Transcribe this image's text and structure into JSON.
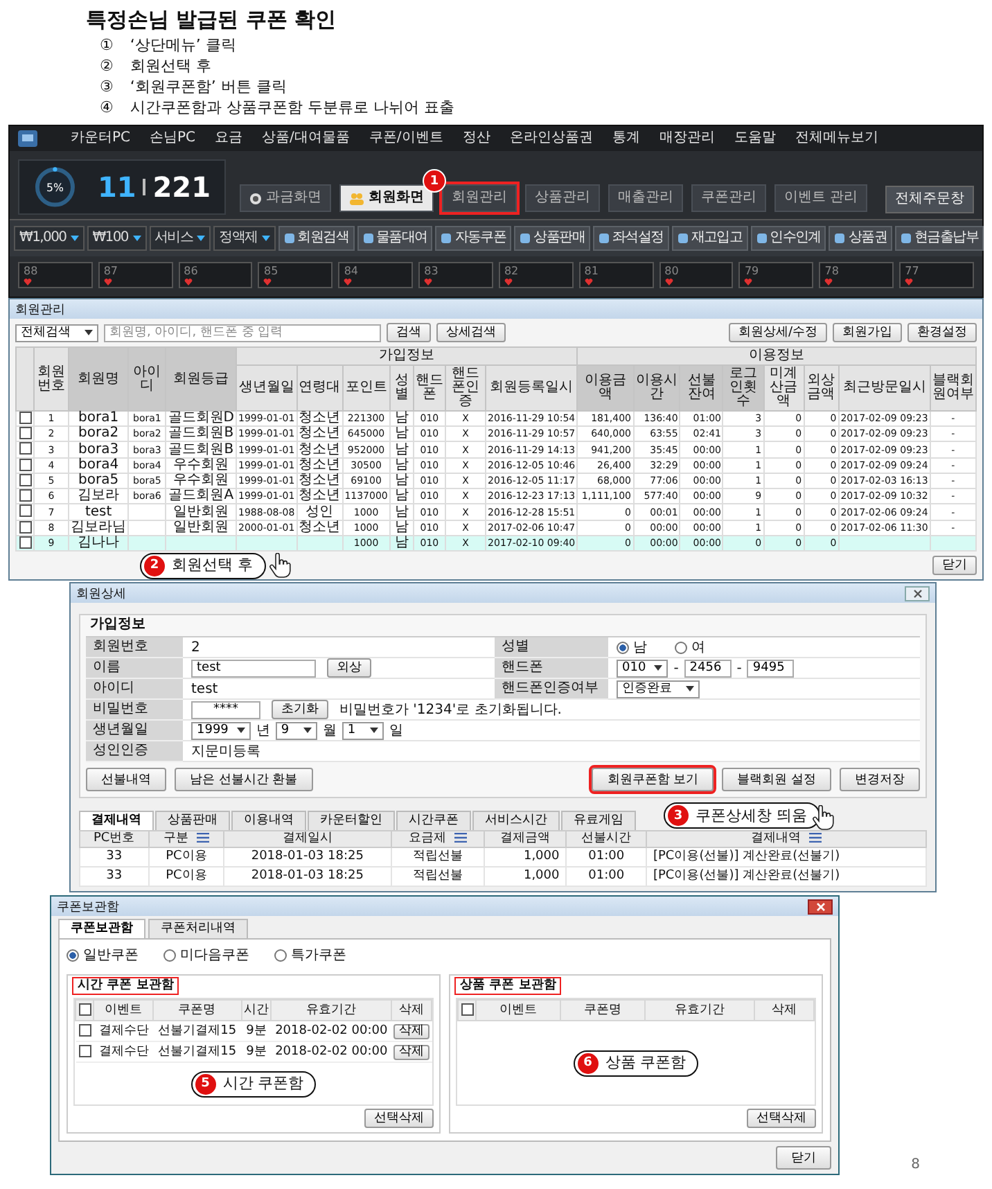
{
  "doc": {
    "title": "특정손님 발급된 쿠폰 확인",
    "steps": [
      {
        "marker": "①",
        "text": "‘상단메뉴’ 클릭"
      },
      {
        "marker": "②",
        "text": "회원선택 후"
      },
      {
        "marker": "③",
        "text": "‘회원쿠폰함’ 버튼 클릭"
      },
      {
        "marker": "④",
        "text": "시간쿠폰함과 상품쿠폰함 두분류로 나뉘어 표출"
      }
    ],
    "page_number": "8"
  },
  "main_app": {
    "menu": [
      "카운터PC",
      "손님PC",
      "요금",
      "상품/대여물품",
      "쿠폰/이벤트",
      "정산",
      "온라인상품권",
      "통계",
      "매장관리",
      "도움말",
      "전체메뉴보기"
    ],
    "usage": "5%",
    "count_used": "11",
    "count_total": "221",
    "tabs": [
      {
        "label": "과금화면",
        "selected": false,
        "highlighted": false
      },
      {
        "label": "회원화면",
        "selected": true,
        "highlighted": false
      },
      {
        "label": "회원관리",
        "selected": false,
        "highlighted": true
      },
      {
        "label": "상품관리",
        "selected": false,
        "highlighted": false
      },
      {
        "label": "매출관리",
        "selected": false,
        "highlighted": false
      },
      {
        "label": "쿠폰관리",
        "selected": false,
        "highlighted": false
      },
      {
        "label": "이벤트 관리",
        "selected": false,
        "highlighted": false
      }
    ],
    "callout": {
      "number": "1"
    },
    "order_button": "전체주문창",
    "toolbar": [
      {
        "kind": "dropdown",
        "label": "₩1,000"
      },
      {
        "kind": "dropdown",
        "label": "₩100"
      },
      {
        "kind": "dropdown",
        "label": "서비스"
      },
      {
        "kind": "dropdown",
        "label": "정액제"
      },
      {
        "kind": "button",
        "label": "회원검색"
      },
      {
        "kind": "button",
        "label": "물품대여"
      },
      {
        "kind": "button",
        "label": "자동쿠폰"
      },
      {
        "kind": "button",
        "label": "상품판매"
      },
      {
        "kind": "button",
        "label": "좌석설정"
      },
      {
        "kind": "button",
        "label": "재고입고"
      },
      {
        "kind": "button",
        "label": "인수인계"
      },
      {
        "kind": "button",
        "label": "상품권"
      },
      {
        "kind": "button",
        "label": "현금출납부"
      }
    ],
    "seats": [
      "88",
      "87",
      "86",
      "85",
      "84",
      "83",
      "82",
      "81",
      "80",
      "79",
      "78",
      "77"
    ]
  },
  "member_window": {
    "title": "회원관리",
    "search": {
      "scope": "전체검색",
      "placeholder": "회원명, 아이디, 핸드폰 중 입력",
      "buttons": [
        "검색",
        "상세검색"
      ]
    },
    "actions": [
      "회원상세/수정",
      "회원가입",
      "환경설정"
    ],
    "lead_columns": [
      "회원번호",
      "회원명",
      "아이디",
      "회원등급"
    ],
    "groups": [
      {
        "label": "가입정보",
        "columns": [
          "생년월일",
          "연령대",
          "포인트",
          "성별",
          "핸드폰",
          "핸드폰인증",
          "회원등록일시"
        ]
      },
      {
        "label": "이용정보",
        "columns": [
          "이용금액",
          "이용시간",
          "선불잔여",
          "로그인횟수",
          "미계산금액",
          "외상금액",
          "최근방문일시",
          "블랙회원여부"
        ]
      }
    ],
    "rows": [
      {
        "checked": false,
        "selected": false,
        "cells": [
          "1",
          "bora1",
          "bora1",
          "골드회원D",
          "1999-01-01",
          "청소년",
          "221300",
          "남",
          "010",
          "X",
          "2016-11-29 10:54",
          "181,400",
          "136:40",
          "01:00",
          "3",
          "0",
          "0",
          "2017-02-09 09:23",
          "-"
        ]
      },
      {
        "checked": false,
        "selected": false,
        "cells": [
          "2",
          "bora2",
          "bora2",
          "골드회원B",
          "1999-01-01",
          "청소년",
          "645000",
          "남",
          "010",
          "X",
          "2016-11-29 10:57",
          "640,000",
          "63:55",
          "02:41",
          "3",
          "0",
          "0",
          "2017-02-09 09:23",
          "-"
        ]
      },
      {
        "checked": false,
        "selected": false,
        "cells": [
          "3",
          "bora3",
          "bora3",
          "골드회원B",
          "1999-01-01",
          "청소년",
          "952000",
          "남",
          "010",
          "X",
          "2016-11-29 14:13",
          "941,200",
          "35:45",
          "00:00",
          "1",
          "0",
          "0",
          "2017-02-09 09:23",
          "-"
        ]
      },
      {
        "checked": false,
        "selected": false,
        "cells": [
          "4",
          "bora4",
          "bora4",
          "우수회원",
          "1999-01-01",
          "청소년",
          "30500",
          "남",
          "010",
          "X",
          "2016-12-05 10:46",
          "26,400",
          "32:29",
          "00:00",
          "1",
          "0",
          "0",
          "2017-02-09 09:24",
          "-"
        ]
      },
      {
        "checked": false,
        "selected": false,
        "cells": [
          "5",
          "bora5",
          "bora5",
          "우수회원",
          "1999-01-01",
          "청소년",
          "69100",
          "남",
          "010",
          "X",
          "2016-12-05 11:17",
          "68,000",
          "77:06",
          "00:00",
          "1",
          "0",
          "0",
          "2017-02-03 16:13",
          "-"
        ]
      },
      {
        "checked": false,
        "selected": false,
        "cells": [
          "6",
          "김보라",
          "bora6",
          "골드회원A",
          "1999-01-01",
          "청소년",
          "1137000",
          "남",
          "010",
          "X",
          "2016-12-23 17:13",
          "1,111,100",
          "577:40",
          "00:00",
          "9",
          "0",
          "0",
          "2017-02-09 10:32",
          "-"
        ]
      },
      {
        "checked": false,
        "selected": false,
        "cells": [
          "7",
          "test",
          null,
          "일반회원",
          "1988-08-08",
          "성인",
          "1000",
          "남",
          "010",
          "X",
          "2016-12-28 15:51",
          "0",
          "00:01",
          "00:00",
          "1",
          "0",
          "0",
          "2017-02-06 09:24",
          "-"
        ]
      },
      {
        "checked": false,
        "selected": false,
        "cells": [
          "8",
          "김보라님",
          null,
          "일반회원",
          "2000-01-01",
          "청소년",
          "1000",
          "남",
          "010",
          "X",
          "2017-02-06 10:47",
          "0",
          "00:00",
          "00:00",
          "1",
          "0",
          "0",
          "2017-02-06 11:30",
          "-"
        ]
      },
      {
        "checked": false,
        "selected": true,
        "cells": [
          "9",
          "김나나",
          null,
          null,
          null,
          null,
          "1000",
          "남",
          "010",
          "X",
          "2017-02-10 09:40",
          "0",
          "00:00",
          "00:00",
          "0",
          "0",
          "0",
          null,
          null
        ]
      }
    ],
    "close": "닫기",
    "callout": {
      "number": "2",
      "text": "회원선택 후"
    }
  },
  "detail_window": {
    "title": "회원상세",
    "section": "가입정보",
    "member_no": {
      "label": "회원번호",
      "value": "2"
    },
    "name": {
      "label": "이름",
      "value": "test",
      "button": "외상"
    },
    "id": {
      "label": "아이디",
      "value": "test"
    },
    "password": {
      "label": "비밀번호",
      "value": "****",
      "button": "초기화",
      "note": "비밀번호가 '1234'로 초기화됩니다."
    },
    "birth": {
      "label": "생년월일",
      "year": "1999",
      "year_unit": "년",
      "month": "9",
      "month_unit": "월",
      "day": "1",
      "day_unit": "일"
    },
    "adult": {
      "label": "성인인증",
      "value": "지문미등록"
    },
    "gender": {
      "label": "성별",
      "options": [
        {
          "label": "남",
          "selected": true
        },
        {
          "label": "여",
          "selected": false
        }
      ]
    },
    "phone": {
      "label": "핸드폰",
      "prefix": "010",
      "middle": "2456",
      "last": "9495",
      "separators": [
        "-",
        "-"
      ]
    },
    "phone_verify": {
      "label": "핸드폰인증여부",
      "value": "인증완료"
    },
    "buttons": [
      {
        "label": "선불내역",
        "highlighted": false
      },
      {
        "label": "남은 선불시간 환불",
        "highlighted": false
      },
      {
        "label": "회원쿠폰함 보기",
        "highlighted": true
      },
      {
        "label": "블랙회원 설정",
        "highlighted": false
      },
      {
        "label": "변경저장",
        "highlighted": false
      }
    ],
    "tabs": [
      {
        "label": "결제내역",
        "selected": true
      },
      {
        "label": "상품판매",
        "selected": false
      },
      {
        "label": "이용내역",
        "selected": false
      },
      {
        "label": "카운터할인",
        "selected": false
      },
      {
        "label": "시간쿠폰",
        "selected": false
      },
      {
        "label": "서비스시간",
        "selected": false
      },
      {
        "label": "유료게임",
        "selected": false
      }
    ],
    "history": {
      "columns": [
        {
          "label": "PC번호",
          "menu": false
        },
        {
          "label": "구분",
          "menu": true
        },
        {
          "label": "결제일시",
          "menu": false
        },
        {
          "label": "요금제",
          "menu": true
        },
        {
          "label": "결제금액",
          "menu": false
        },
        {
          "label": "선불시간",
          "menu": false
        },
        {
          "label": "결제내역",
          "menu": true
        }
      ],
      "rows": [
        [
          "33",
          "PC이용",
          "2018-01-03 18:25",
          "적립선불",
          "1,000",
          "01:00",
          "[PC이용(선불)] 계산완료(선불기)"
        ],
        [
          "33",
          "PC이용",
          "2018-01-03 18:25",
          "적립선불",
          "1,000",
          "01:00",
          "[PC이용(선불)] 계산완료(선불기)"
        ]
      ]
    },
    "callout": {
      "number": "3",
      "text": "쿠폰상세창 띄움"
    }
  },
  "coupon_window": {
    "title": "쿠폰보관함",
    "tabs": [
      {
        "label": "쿠폰보관함",
        "selected": true
      },
      {
        "label": "쿠폰처리내역",
        "selected": false
      }
    ],
    "types": [
      {
        "label": "일반쿠폰",
        "selected": true
      },
      {
        "label": "미다음쿠폰",
        "selected": false
      },
      {
        "label": "특가쿠폰",
        "selected": false
      }
    ],
    "panels": [
      {
        "title": "시간 쿠폰 보관함",
        "all_checked": false,
        "columns": [
          "이벤트",
          "쿠폰명",
          "시간",
          "유효기간",
          "삭제"
        ],
        "rows": [
          {
            "checked": false,
            "cells": [
              "결제수단",
              "선불기결제15",
              "9분",
              "2018-02-02 00:00"
            ],
            "action": "삭제"
          },
          {
            "checked": false,
            "cells": [
              "결제수단",
              "선불기결제15",
              "9분",
              "2018-02-02 00:00"
            ],
            "action": "삭제"
          }
        ],
        "delete_selected": "선택삭제",
        "callout": {
          "number": "5",
          "text": "시간 쿠폰함"
        }
      },
      {
        "title": "상품 쿠폰 보관함",
        "all_checked": false,
        "columns": [
          "이벤트",
          "쿠폰명",
          "유효기간",
          "삭제"
        ],
        "delete_selected": "선택삭제",
        "callout": {
          "number": "6",
          "text": "상품 쿠폰함"
        }
      }
    ],
    "close": "닫기"
  }
}
